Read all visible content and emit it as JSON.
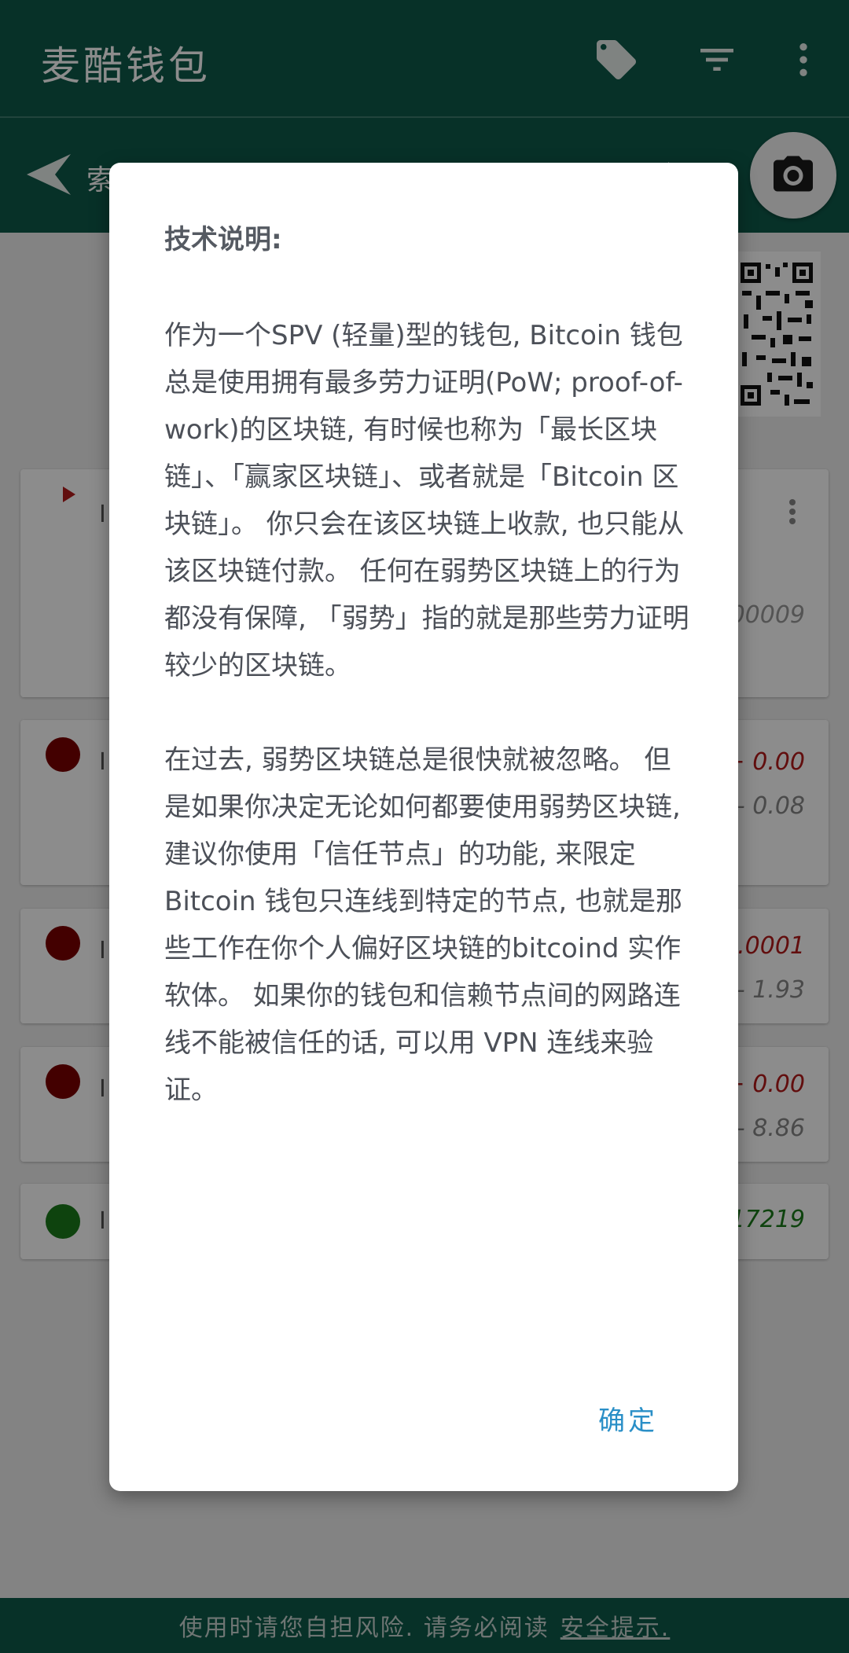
{
  "app": {
    "title": "麦酷钱包",
    "subbar_partial_text": "索",
    "icons": [
      "tag-icon",
      "filter-icon",
      "more-vert-icon",
      "back-arrow-icon",
      "camera-icon"
    ]
  },
  "transactions": [
    {
      "lead": "I",
      "amount": "00009",
      "sub": "",
      "status_color": "#b31b1b",
      "type": "pending"
    },
    {
      "lead": "I",
      "amount": "+ 0.00",
      "sub": "- 0.08",
      "status_color": "#7a0000"
    },
    {
      "lead": "I",
      "amount": "0.0001",
      "sub": "- 1.93",
      "status_color": "#7a0000"
    },
    {
      "lead": "I",
      "amount": "+ 0.00",
      "sub": "- 8.86",
      "status_color": "#7a0000"
    },
    {
      "lead": "I",
      "amount": "17219",
      "sub": "",
      "status_color": "#1a7a1a"
    }
  ],
  "dialog": {
    "title": "技术说明:",
    "paragraphs": [
      "作为一个SPV (轻量)型的钱包, Bitcoin 钱包总是使用拥有最多劳力证明(PoW; proof-of-work)的区块链, 有时候也称为「最长区块链」、「赢家区块链」、或者就是「Bitcoin 区块链」。 你只会在该区块链上收款, 也只能从该区块链付款。 任何在弱势区块链上的行为都没有保障, 「弱势」指的就是那些劳力证明较少的区块链。",
      "在过去, 弱势区块链总是很快就被忽略。 但是如果你决定无论如何都要使用弱势区块链, 建议你使用「信任节点」的功能, 来限定Bitcoin 钱包只连线到特定的节点, 也就是那些工作在你个人偏好区块链的bitcoind 实作软体。 如果你的钱包和信赖节点间的网路连线不能被信任的话, 可以用 VPN 连线来验证。"
    ],
    "ok_label": "确定"
  },
  "footer": {
    "text": "使用时请您自担风险. 请务必阅读",
    "link": "安全提示."
  },
  "colors": {
    "primary": "#0e5a4a",
    "accent": "#2a8fc7"
  }
}
